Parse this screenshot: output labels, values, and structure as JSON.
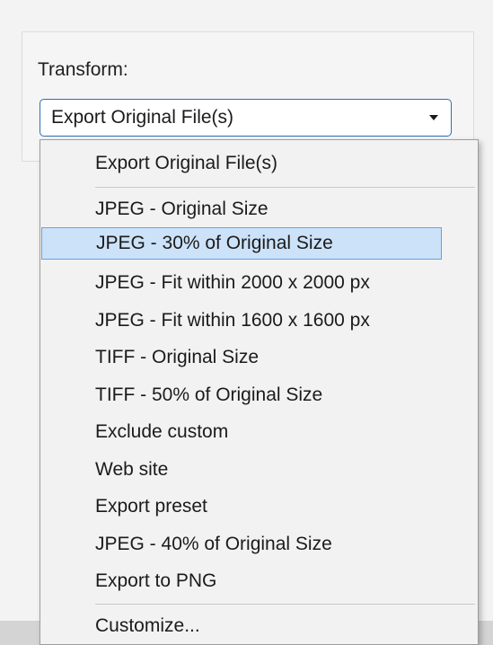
{
  "transform": {
    "label": "Transform:",
    "selected_value": "Export Original File(s)"
  },
  "dropdown": {
    "items": [
      {
        "label": "Export Original File(s)",
        "highlighted": false
      },
      {
        "label": "JPEG - Original Size",
        "highlighted": false
      },
      {
        "label": "JPEG - 30% of Original Size",
        "highlighted": true
      },
      {
        "label": "JPEG - Fit within 2000 x 2000 px",
        "highlighted": false
      },
      {
        "label": "JPEG - Fit within 1600 x 1600 px",
        "highlighted": false
      },
      {
        "label": "TIFF - Original Size",
        "highlighted": false
      },
      {
        "label": "TIFF - 50% of Original Size",
        "highlighted": false
      },
      {
        "label": "Exclude custom",
        "highlighted": false
      },
      {
        "label": "Web site",
        "highlighted": false
      },
      {
        "label": "Export preset",
        "highlighted": false
      },
      {
        "label": "JPEG - 40% of Original Size",
        "highlighted": false
      },
      {
        "label": "Export  to PNG",
        "highlighted": false
      },
      {
        "label": "Customize...",
        "highlighted": false
      }
    ]
  },
  "colors": {
    "highlight_fill": "#cce2f8",
    "highlight_border": "#66a3e0",
    "combo_border": "#2c6fb4"
  },
  "icons": {
    "combo_arrow": "triangle-down"
  }
}
